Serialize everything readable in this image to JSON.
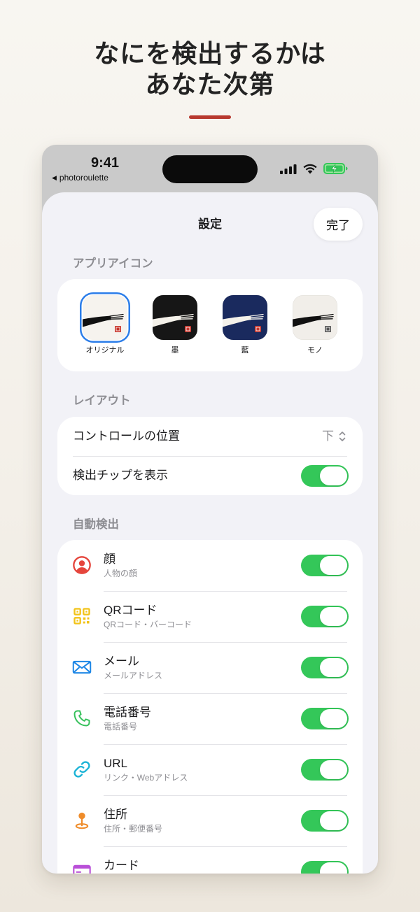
{
  "headline": {
    "line1": "なにを検出するかは",
    "line2": "あなた次第"
  },
  "status_bar": {
    "time": "9:41",
    "back_indicator": "◀",
    "back_app": "photoroulette",
    "icons": [
      "cellular-signal-icon",
      "wifi-icon",
      "battery-charging-icon"
    ]
  },
  "sheet": {
    "title": "設定",
    "done_label": "完了"
  },
  "app_icon_section": {
    "header": "アプリアイコン",
    "icons": [
      {
        "label": "オリジナル",
        "background": "#f6f3ee",
        "stroke": "#111111",
        "seal": "#c8352c",
        "selected": true
      },
      {
        "label": "墨",
        "background": "#161616",
        "stroke": "#f4f1ea",
        "seal": "#c8352c",
        "selected": false
      },
      {
        "label": "藍",
        "background": "#1a2a5e",
        "stroke": "#f4f1ea",
        "seal": "#c8352c",
        "selected": false
      },
      {
        "label": "モノ",
        "background": "#f1eee9",
        "stroke": "#111111",
        "seal": "#555555",
        "selected": false
      }
    ]
  },
  "layout_section": {
    "header": "レイアウト",
    "control_position": {
      "label": "コントロールの位置",
      "value": "下"
    },
    "show_chips": {
      "label": "検出チップを表示",
      "enabled": true
    }
  },
  "auto_detect_section": {
    "header": "自動検出",
    "items": [
      {
        "title": "顔",
        "subtitle": "人物の顔",
        "icon": "face-icon",
        "color": "#e5453c",
        "enabled": true
      },
      {
        "title": "QRコード",
        "subtitle": "QRコード・バーコード",
        "icon": "qr-code-icon",
        "color": "#f2c318",
        "enabled": true
      },
      {
        "title": "メール",
        "subtitle": "メールアドレス",
        "icon": "envelope-icon",
        "color": "#1c86e6",
        "enabled": true
      },
      {
        "title": "電話番号",
        "subtitle": "電話番号",
        "icon": "phone-icon",
        "color": "#35c05a",
        "enabled": true
      },
      {
        "title": "URL",
        "subtitle": "リンク・Webアドレス",
        "icon": "link-icon",
        "color": "#1bb3d6",
        "enabled": true
      },
      {
        "title": "住所",
        "subtitle": "住所・郵便番号",
        "icon": "map-pin-icon",
        "color": "#ef8c2a",
        "enabled": true
      },
      {
        "title": "カード",
        "icon": "card-icon",
        "color": "#b94fd8",
        "enabled": true
      }
    ]
  },
  "colors": {
    "accent_red": "#b8392f",
    "toggle_on": "#34c759",
    "selection_blue": "#2b7de9",
    "sheet_background": "#f2f2f7",
    "secondary_text": "#8e8e93"
  }
}
